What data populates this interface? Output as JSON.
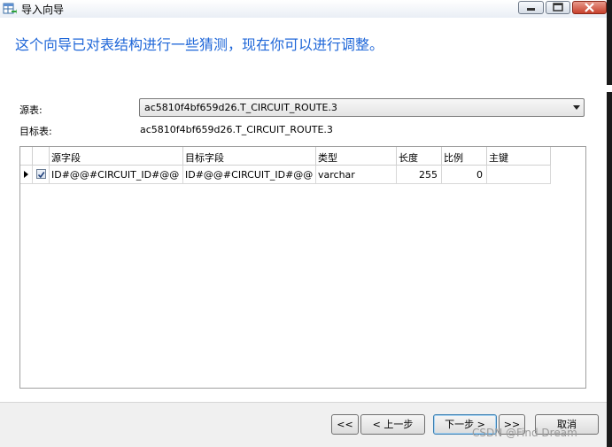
{
  "window": {
    "title": "导入向导",
    "minimize_icon": "minimize-icon",
    "maximize_icon": "maximize-icon",
    "close_icon": "close-icon"
  },
  "heading": "这个向导已对表结构进行一些猜测，现在你可以进行调整。",
  "source": {
    "label": "源表:",
    "value": "ac5810f4bf659d26.T_CIRCUIT_ROUTE.3"
  },
  "target": {
    "label": "目标表:",
    "value": "ac5810f4bf659d26.T_CIRCUIT_ROUTE.3"
  },
  "grid": {
    "columns": [
      "源字段",
      "目标字段",
      "类型",
      "长度",
      "比例",
      "主键"
    ],
    "rows": [
      {
        "checked": true,
        "source_field": "ID#@@#CIRCUIT_ID#@@",
        "target_field": "ID#@@#CIRCUIT_ID#@@",
        "type": "varchar",
        "length": "255",
        "scale": "0",
        "primary_key": ""
      }
    ]
  },
  "buttons": {
    "first": "<<",
    "prev": "< 上一步",
    "next": "下一步 >",
    "last": ">>",
    "cancel": "取消"
  },
  "watermark": "CSDN @Find Dream"
}
